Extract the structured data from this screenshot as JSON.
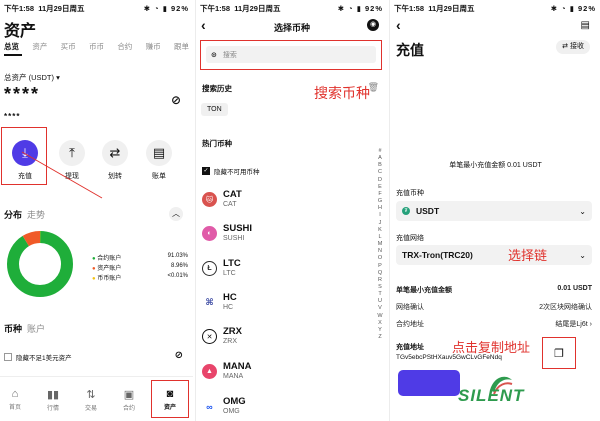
{
  "status_bar": {
    "time": "下午1:58",
    "date": "11月29日周五",
    "battery": "92%"
  },
  "panel1": {
    "title": "资产",
    "tabs": [
      "总览",
      "资产",
      "买币",
      "币币",
      "合约",
      "赚币",
      "跟单"
    ],
    "total_label": "总资产 (USDT)",
    "total_value": "****",
    "sub_value": "****",
    "actions": [
      {
        "label": "充值",
        "icon": "deposit-icon"
      },
      {
        "label": "提现",
        "icon": "withdraw-icon"
      },
      {
        "label": "划转",
        "icon": "transfer-icon"
      },
      {
        "label": "账单",
        "icon": "bill-icon"
      }
    ],
    "dist_tabs": [
      "分布",
      "走势"
    ],
    "legend": [
      {
        "label": "合约账户",
        "value": "91.03%",
        "color": "#1fae3a"
      },
      {
        "label": "资产账户",
        "value": "8.96%",
        "color": "#f05a28"
      },
      {
        "label": "币币账户",
        "value": "<0.01%",
        "color": "#f3c316"
      }
    ],
    "donut_fractions": [
      0.9103,
      0.0896,
      0.0001
    ],
    "section_tabs": [
      "币种",
      "账户"
    ],
    "hide_small_label": "隐藏不足1美元资产",
    "bottom_nav": [
      "首页",
      "行情",
      "交易",
      "合约",
      "资产"
    ]
  },
  "panel2": {
    "title": "选择币种",
    "search_placeholder": "搜索",
    "annotation": "搜索币种",
    "history_label": "搜索历史",
    "history_items": [
      "TON"
    ],
    "hot_label": "热门币种",
    "hide_unavailable_label": "隐藏不可用币种",
    "coins": [
      {
        "symbol": "CAT",
        "sub": "CAT",
        "color": "#d9534f"
      },
      {
        "symbol": "SUSHI",
        "sub": "SUSHI",
        "color": "#e05ba8"
      },
      {
        "symbol": "LTC",
        "sub": "LTC",
        "color": "#2d2d2d"
      },
      {
        "symbol": "HC",
        "sub": "HC",
        "color": "#3d4ba3"
      },
      {
        "symbol": "ZRX",
        "sub": "ZRX",
        "color": "#111111"
      },
      {
        "symbol": "MANA",
        "sub": "MANA",
        "color": "#e8456b"
      },
      {
        "symbol": "OMG",
        "sub": "OMG",
        "color": "#1a53f0"
      }
    ],
    "alphabet": [
      "#",
      "A",
      "B",
      "C",
      "D",
      "E",
      "F",
      "G",
      "H",
      "I",
      "J",
      "K",
      "L",
      "M",
      "N",
      "O",
      "P",
      "Q",
      "R",
      "S",
      "T",
      "U",
      "V",
      "W",
      "X",
      "Y",
      "Z"
    ]
  },
  "panel3": {
    "title": "充值",
    "receive_label": "接收",
    "min_single": "单笔最小充值金额 0.01 USDT",
    "coin_label": "充值币种",
    "coin_value": "USDT",
    "network_label": "充值网络",
    "network_value": "TRX-Tron(TRC20)",
    "network_annotation": "选择链",
    "rows": [
      {
        "label": "单笔最小充值金额",
        "value": "0.01 USDT"
      },
      {
        "label": "网络确认",
        "value": "2次区块网络确认"
      },
      {
        "label": "合约地址",
        "value": "结尾是Lj6t"
      }
    ],
    "address_label": "充值地址",
    "address_annotation": "点击复制地址",
    "address_value": "TGv5ebcPStHXauv5GwCLvGFeNdq",
    "watermark": "SILENT"
  }
}
